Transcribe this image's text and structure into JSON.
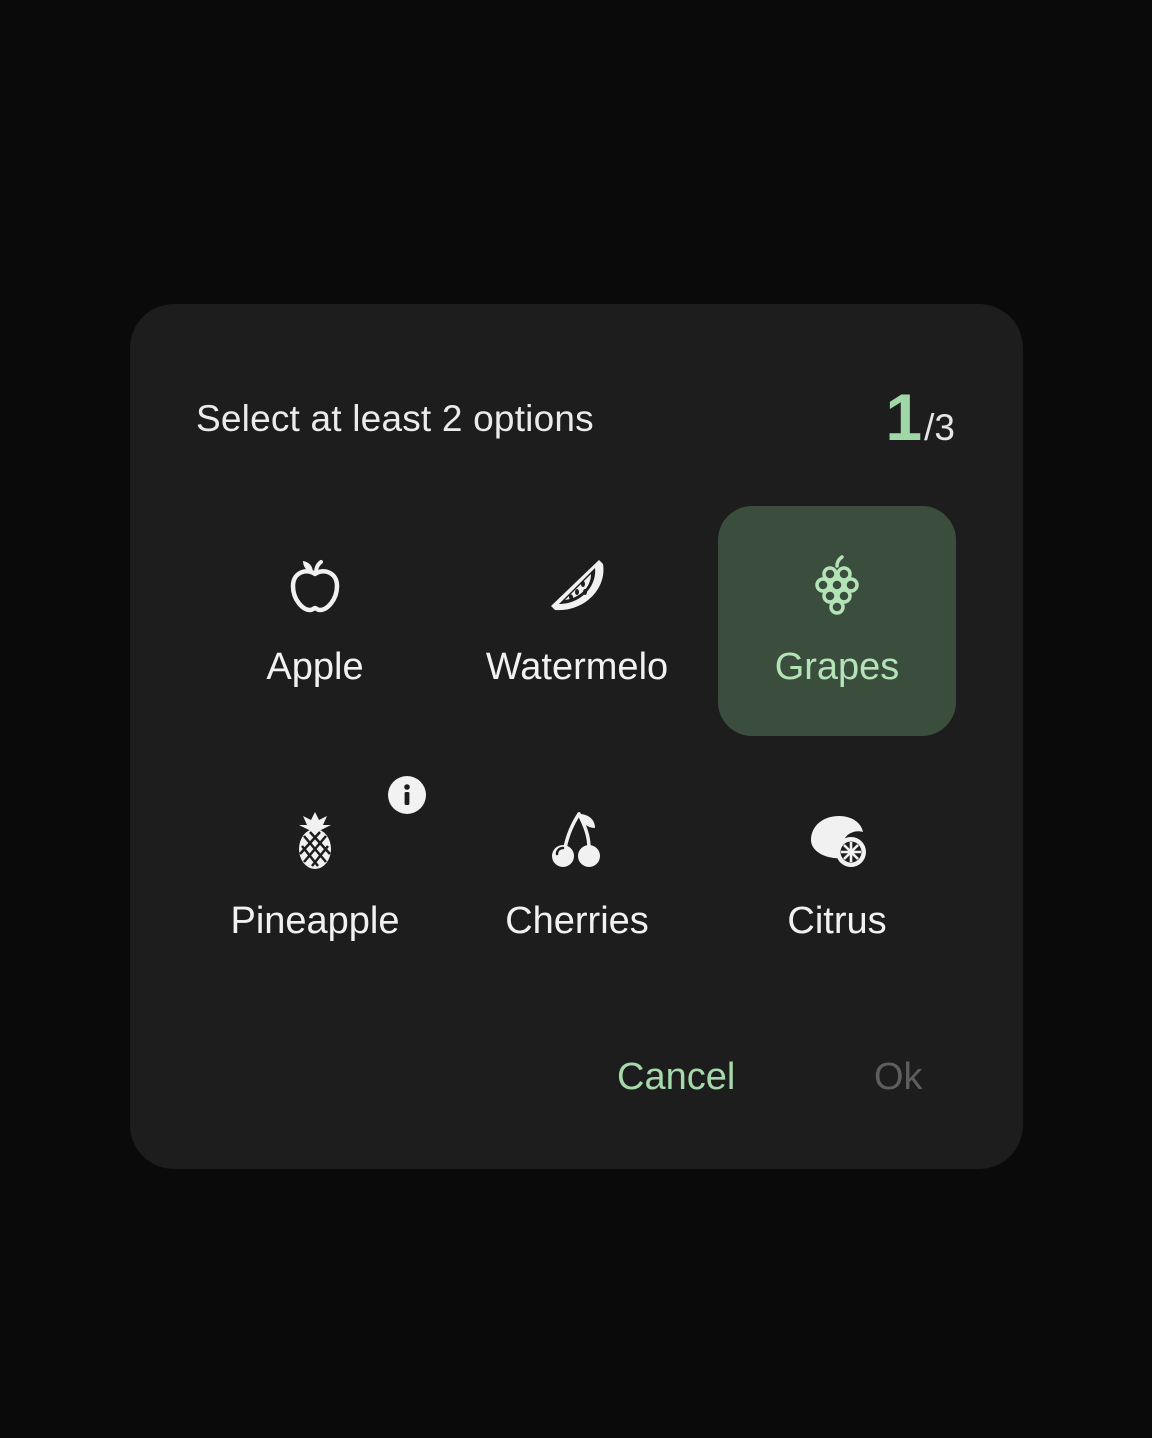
{
  "dialog": {
    "title": "Select at least 2 options",
    "counter_current": "1",
    "counter_total": "/3",
    "cancel_label": "Cancel",
    "ok_label": "Ok"
  },
  "options": [
    {
      "label": "Apple",
      "icon": "apple-icon",
      "selected": false
    },
    {
      "label": "Watermelo",
      "icon": "watermelon-icon",
      "selected": false
    },
    {
      "label": "Grapes",
      "icon": "grapes-icon",
      "selected": true
    },
    {
      "label": "Pineapple",
      "icon": "pineapple-icon",
      "selected": false,
      "has_info": true
    },
    {
      "label": "Cherries",
      "icon": "cherries-icon",
      "selected": false
    },
    {
      "label": "Citrus",
      "icon": "citrus-icon",
      "selected": false
    }
  ],
  "colors": {
    "accent": "#9fd7a6",
    "selected_bg": "#3b4e3d",
    "dialog_bg": "#1d1d1d",
    "disabled_text": "#5e5e5e"
  }
}
